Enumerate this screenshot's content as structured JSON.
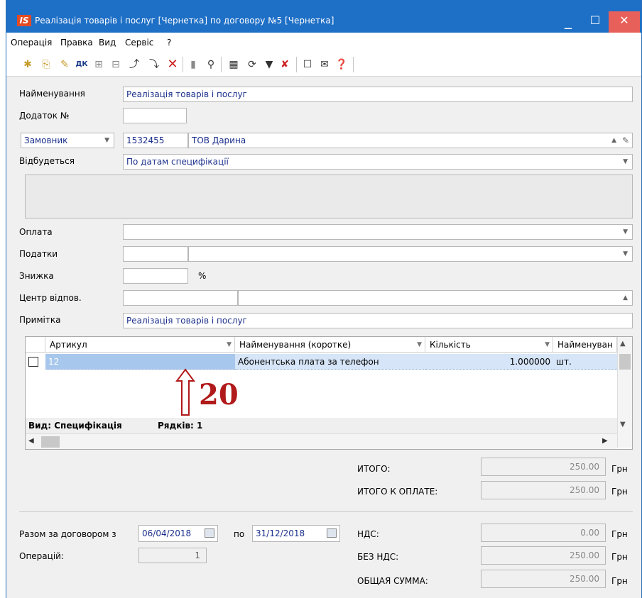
{
  "window": {
    "title": "Реалізація товарів і послуг [Чернетка] по договору №5 [Чернетка]",
    "logo": "IS",
    "minimize": "_",
    "maximize": "☐",
    "close": "✕"
  },
  "menu": [
    "Операція",
    "Правка",
    "Вид",
    "Сервіс",
    "?"
  ],
  "toolbar_icons": [
    "new-doc-icon",
    "copy-doc-icon",
    "edit-doc-icon",
    "dk-icon",
    "tree-icon",
    "hierarchy-icon",
    "insert-icon",
    "paste-icon",
    "delete-icon",
    "card-icon",
    "search-icon",
    "table-icon",
    "refresh-icon",
    "filter-icon",
    "clear-filter-icon",
    "form-icon",
    "mail-icon",
    "help-icon"
  ],
  "form": {
    "name_label": "Найменування",
    "name_value": "Реалізація товарів і послуг",
    "addendum_label": "Додаток №",
    "addendum_value": "",
    "party_type": "Замовник",
    "party_code": "1532455",
    "party_name": "ТОВ Дарина",
    "occurs_label": "Відбудеться",
    "occurs_value": "По датам специфікації",
    "payment_label": "Оплата",
    "payment_value": "",
    "taxes_label": "Податки",
    "discount_label": "Знижка",
    "discount_unit": "%",
    "center_label": "Центр відпов.",
    "note_label": "Примітка",
    "note_value": "Реалізація товарів і послуг"
  },
  "grid": {
    "columns": [
      "Артикул",
      "Найменування (коротке)",
      "Кількість",
      "Найменуван"
    ],
    "rows": [
      {
        "article": "12",
        "name": "Абонентська плата за телефон",
        "qty": "1.000000",
        "unit": "шт."
      }
    ],
    "view_label": "Вид: Специфікація",
    "rows_label": "Рядків: 1",
    "annotation": "20"
  },
  "totals": {
    "total_label": "ИТОГО:",
    "total_value": "250.00",
    "to_pay_label": "ИТОГО К ОПЛАТЕ:",
    "to_pay_value": "250.00",
    "vat_label": "НДС:",
    "vat_value": "0.00",
    "novat_label": "БЕЗ НДС:",
    "novat_value": "250.00",
    "sum_label": "ОБЩАЯ СУММА:",
    "sum_value": "250.00",
    "currency": "Грн"
  },
  "contract": {
    "from_label": "Разом за договором з",
    "from_date": "06/04/2018",
    "to_label": "по",
    "to_date": "31/12/2018",
    "ops_label": "Операцій:",
    "ops_value": "1"
  }
}
